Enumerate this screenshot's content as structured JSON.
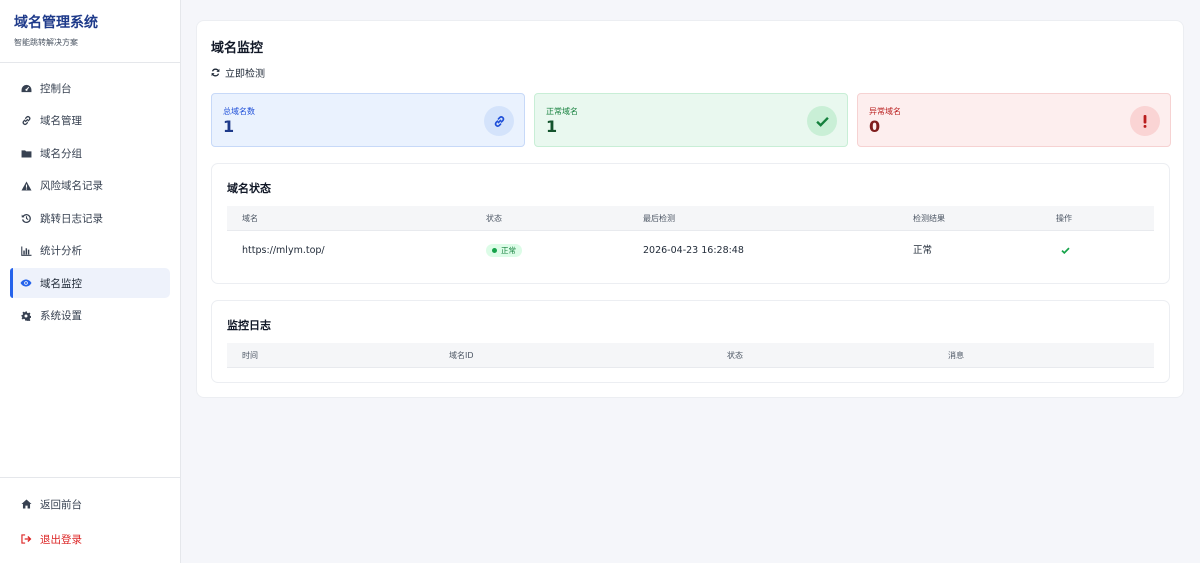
{
  "brand": {
    "title": "域名管理系统",
    "subtitle": "智能跳转解决方案"
  },
  "sidebar": {
    "items": [
      {
        "label": "控制台",
        "icon": "dashboard-icon"
      },
      {
        "label": "域名管理",
        "icon": "link-icon"
      },
      {
        "label": "域名分组",
        "icon": "folder-icon"
      },
      {
        "label": "风险域名记录",
        "icon": "warning-icon"
      },
      {
        "label": "跳转日志记录",
        "icon": "history-icon"
      },
      {
        "label": "统计分析",
        "icon": "bar-chart-icon"
      },
      {
        "label": "域名监控",
        "icon": "eye-icon",
        "active": true
      },
      {
        "label": "系统设置",
        "icon": "gear-icon"
      }
    ],
    "bottom": [
      {
        "label": "返回前台",
        "icon": "home-icon"
      },
      {
        "label": "退出登录",
        "icon": "logout-icon"
      }
    ]
  },
  "main": {
    "title": "域名监控",
    "check_button": "立即检测",
    "stats": {
      "total": {
        "label": "总域名数",
        "value": "1"
      },
      "normal": {
        "label": "正常域名",
        "value": "1"
      },
      "abnormal": {
        "label": "异常域名",
        "value": "0"
      }
    },
    "status_panel": {
      "title": "域名状态",
      "columns": [
        "域名",
        "状态",
        "最后检测",
        "检测结果",
        "操作"
      ],
      "rows": [
        {
          "domain": "https://mlym.top/",
          "status": "正常",
          "last_check": "2026-04-23 16:28:48",
          "result": "正常"
        }
      ]
    },
    "log_panel": {
      "title": "监控日志",
      "columns": [
        "时间",
        "域名ID",
        "状态",
        "消息"
      ]
    }
  },
  "colors": {
    "accent": "#2563eb",
    "success": "#16a34a",
    "danger": "#dc2626",
    "brand": "#1e3a8a"
  }
}
